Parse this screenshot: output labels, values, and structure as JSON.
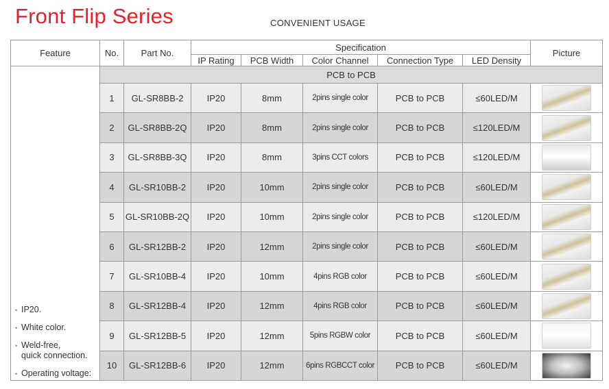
{
  "header": {
    "title": "Front Flip Series",
    "subtitle": "CONVENIENT USAGE"
  },
  "table": {
    "col_feature": "Feature",
    "col_no": "No.",
    "col_part": "Part No.",
    "col_spec": "Specification",
    "col_ip": "IP Rating",
    "col_pcb": "PCB Width",
    "col_color": "Color Channel",
    "col_conn": "Connection Type",
    "col_led": "LED Density",
    "col_picture": "Picture",
    "band_label": "PCB to PCB",
    "features": [
      "IP20.",
      "White color.",
      "Weld-free,\nquick connection.",
      "Operating voltage:"
    ],
    "rows": [
      {
        "no": "1",
        "part": "GL-SR8BB-2",
        "ip": "IP20",
        "pcb": "8mm",
        "color": "2pins single color",
        "conn": "PCB to PCB",
        "led": "≤60LED/M",
        "pic_icon": "led-strip-connector-photo"
      },
      {
        "no": "2",
        "part": "GL-SR8BB-2Q",
        "ip": "IP20",
        "pcb": "8mm",
        "color": "2pins single color",
        "conn": "PCB to PCB",
        "led": "≤120LED/M",
        "pic_icon": "led-strip-connector-photo"
      },
      {
        "no": "3",
        "part": "GL-SR8BB-3Q",
        "ip": "IP20",
        "pcb": "8mm",
        "color": "3pins CCT colors",
        "conn": "PCB to PCB",
        "led": "≤120LED/M",
        "pic_icon": "connector-closeup-photo"
      },
      {
        "no": "4",
        "part": "GL-SR10BB-2",
        "ip": "IP20",
        "pcb": "10mm",
        "color": "2pins single color",
        "conn": "PCB to PCB",
        "led": "≤60LED/M",
        "pic_icon": "led-strip-connector-photo"
      },
      {
        "no": "5",
        "part": "GL-SR10BB-2Q",
        "ip": "IP20",
        "pcb": "10mm",
        "color": "2pins single color",
        "conn": "PCB to PCB",
        "led": "≤120LED/M",
        "pic_icon": "led-strip-connector-photo"
      },
      {
        "no": "6",
        "part": "GL-SR12BB-2",
        "ip": "IP20",
        "pcb": "12mm",
        "color": "2pins single color",
        "conn": "PCB to PCB",
        "led": "≤60LED/M",
        "pic_icon": "led-strip-connector-photo"
      },
      {
        "no": "7",
        "part": "GL-SR10BB-4",
        "ip": "IP20",
        "pcb": "10mm",
        "color": "4pins RGB color",
        "conn": "PCB to PCB",
        "led": "≤60LED/M",
        "pic_icon": "led-strip-connector-photo"
      },
      {
        "no": "8",
        "part": "GL-SR12BB-4",
        "ip": "IP20",
        "pcb": "12mm",
        "color": "4pins RGB color",
        "conn": "PCB to PCB",
        "led": "≤60LED/M",
        "pic_icon": "led-strip-connector-photo"
      },
      {
        "no": "9",
        "part": "GL-SR12BB-5",
        "ip": "IP20",
        "pcb": "12mm",
        "color": "5pins RGBW color",
        "conn": "PCB to PCB",
        "led": "≤60LED/M",
        "pic_icon": "connector-block-photo"
      },
      {
        "no": "10",
        "part": "GL-SR12BB-6",
        "ip": "IP20",
        "pcb": "12mm",
        "color": "6pins RGBCCT color",
        "conn": "PCB to PCB",
        "led": "≤60LED/M",
        "pic_icon": "connector-dark-photo"
      }
    ]
  },
  "colors": {
    "title_red": "#e8202a",
    "row_shade": "#d6d6d6",
    "row_light": "#ececec",
    "band": "#dcdcdc",
    "border": "#9a9a9a"
  }
}
